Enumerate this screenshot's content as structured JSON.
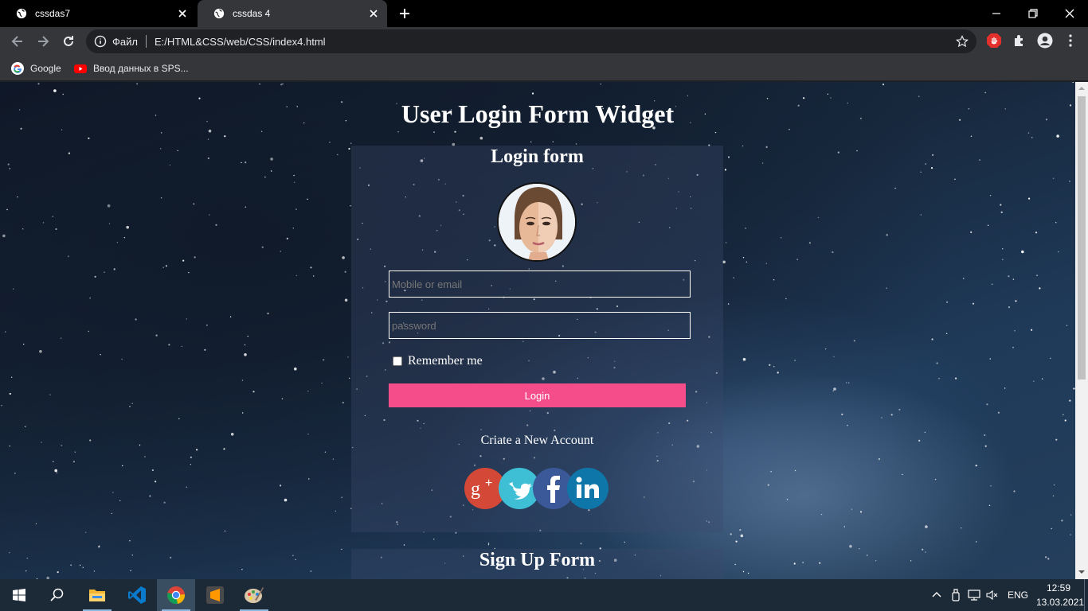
{
  "browser": {
    "tabs": [
      {
        "title": "cssdas7",
        "active": false
      },
      {
        "title": "cssdas 4",
        "active": true
      }
    ],
    "address_bar": {
      "protocol_label": "Файл",
      "url": "E:/HTML&CSS/web/CSS/index4.html"
    },
    "bookmarks": [
      {
        "label": "Google",
        "icon": "google-icon"
      },
      {
        "label": "Ввод данных в SPS...",
        "icon": "youtube-icon"
      }
    ]
  },
  "page": {
    "title": "User Login Form Widget",
    "login_form": {
      "heading": "Login form",
      "email_placeholder": "Mobile or email",
      "password_placeholder": "password",
      "remember_label": "Remember me",
      "remember_checked": false,
      "login_button": "Login",
      "create_account_link": "Criate a New Account",
      "social_icons": [
        "google-plus-icon",
        "twitter-icon",
        "facebook-icon",
        "linkedin-icon"
      ]
    },
    "signup_form": {
      "heading": "Sign Up Form"
    }
  },
  "taskbar": {
    "apps": [
      "start-icon",
      "search-icon",
      "file-explorer-icon",
      "vscode-icon",
      "chrome-icon",
      "sublime-icon",
      "paint-icon"
    ],
    "active_app": "chrome-icon",
    "language": "ENG",
    "time": "12:59",
    "date": "13.03.2021"
  },
  "colors": {
    "login_button": "#f54d8a",
    "tab_strip": "#000000",
    "toolbar": "#35363a",
    "taskbar": "#1c2a38"
  }
}
